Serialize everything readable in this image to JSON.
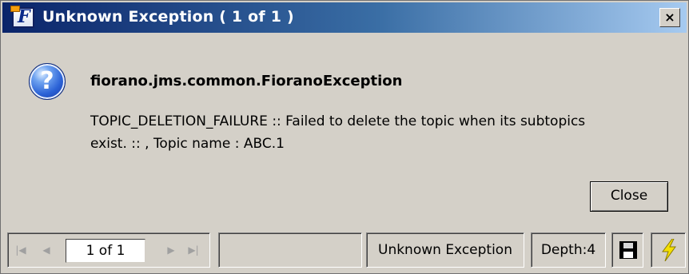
{
  "window": {
    "title": "Unknown Exception ( 1 of 1 )",
    "close_glyph": "×"
  },
  "icons": {
    "app": "fiorano-app-icon",
    "app_glyph": "F",
    "question": "question-icon",
    "question_glyph": "?",
    "first": "first-page-icon",
    "prev": "prev-page-icon",
    "next": "next-page-icon",
    "last": "last-page-icon",
    "save": "save-icon",
    "run": "lightning-icon"
  },
  "exception": {
    "class_name": "fiorano.jms.common.FioranoException",
    "message": "TOPIC_DELETION_FAILURE :: Failed to delete the topic when its subtopics\nexist. :: , Topic name : ABC.1"
  },
  "buttons": {
    "close_label": "Close"
  },
  "status_bar": {
    "nav_first": "|◀",
    "nav_prev": "◀",
    "nav_next": "▶",
    "nav_last": "▶|",
    "page": "1 of 1",
    "exception_type": "Unknown Exception",
    "depth": "Depth:4"
  },
  "colors": {
    "title_start": "#0a246a",
    "title_end": "#a6caf0",
    "dialog_bg": "#d4d0c8",
    "bolt": "#f5e000"
  }
}
